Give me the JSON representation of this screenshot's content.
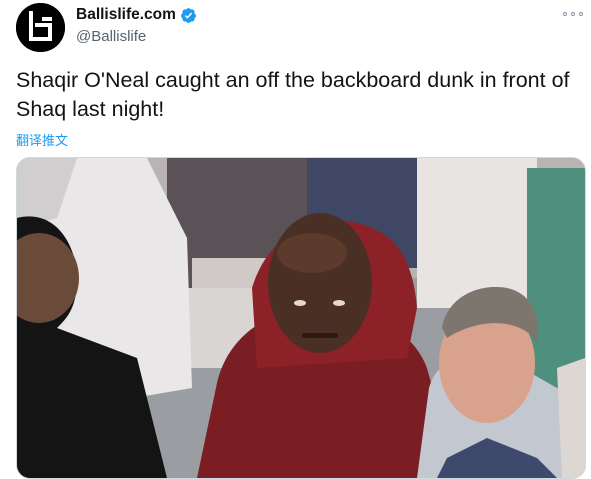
{
  "account": {
    "name": "Ballislife.com",
    "handle": "@Ballislife",
    "avatar_icon": "ballislife-logo-icon",
    "verified_icon": "verified-badge-icon",
    "verified_color": "#1d9bf0"
  },
  "menu": {
    "icon": "more-options-icon"
  },
  "tweet": {
    "text": "Shaqir O'Neal caught an off the backboard dunk in front of Shaq last night!",
    "translate_label": "翻译推文"
  },
  "media": {
    "type": "photo",
    "icon": "photo-crowd-courtside"
  }
}
